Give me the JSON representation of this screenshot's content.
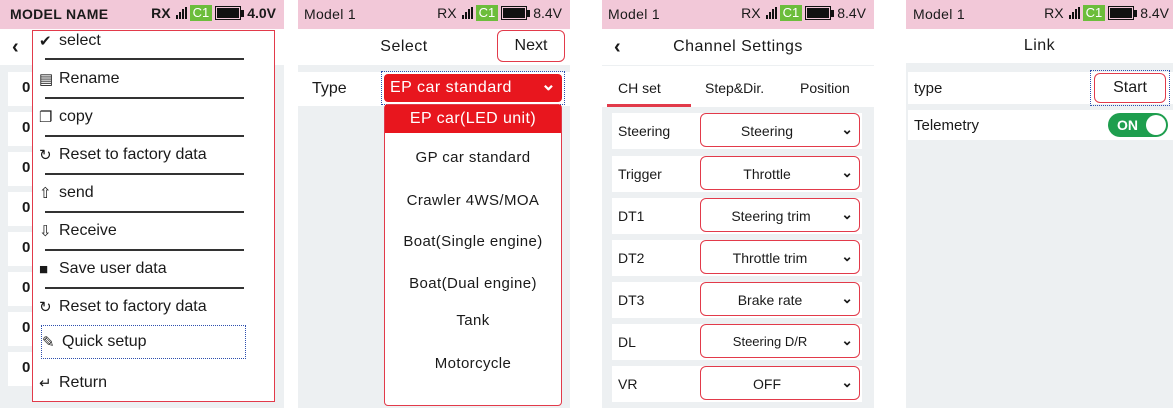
{
  "panel1": {
    "status": {
      "model": "MODEL NAME",
      "rx": "RX",
      "channel": "C1",
      "battery": "4.0V"
    },
    "back_glyph": "‹",
    "bg_rows": [
      "0",
      "0",
      "0",
      "0",
      "0",
      "0",
      "0",
      "0",
      "0"
    ],
    "menu": [
      {
        "icon": "check-icon",
        "glyph": "✔",
        "label": "select"
      },
      {
        "icon": "rename-icon",
        "glyph": "▤",
        "label": "Rename"
      },
      {
        "icon": "copy-icon",
        "glyph": "❐",
        "label": "copy"
      },
      {
        "icon": "refresh-icon",
        "glyph": "↻",
        "label": "Reset to factory data"
      },
      {
        "icon": "upload-icon",
        "glyph": "⇧",
        "label": "send"
      },
      {
        "icon": "download-icon",
        "glyph": "⇩",
        "label": "Receive"
      },
      {
        "icon": "save-icon",
        "glyph": "■",
        "label": "Save user data"
      },
      {
        "icon": "refresh-icon",
        "glyph": "↻",
        "label": "Reset to factory data"
      },
      {
        "icon": "pencil-icon",
        "glyph": "✎",
        "label": "Quick setup"
      },
      {
        "icon": "return-icon",
        "glyph": "↵",
        "label": "Return"
      }
    ]
  },
  "panel2": {
    "status": {
      "model": "Model 1",
      "rx": "RX",
      "channel": "C1",
      "battery": "8.4V"
    },
    "title": "Select",
    "next_label": "Next",
    "type_label": "Type",
    "type_value": "EP car standard",
    "chevron_glyph": "⌄",
    "options": [
      "EP car(LED unit)",
      "GP car standard",
      "Crawler 4WS/MOA",
      "Boat(Single engine)",
      "Boat(Dual engine)",
      "Tank",
      "Motorcycle"
    ],
    "highlight_color": "#e8161e"
  },
  "panel3": {
    "status": {
      "model": "Model 1",
      "rx": "RX",
      "channel": "C1",
      "battery": "8.4V"
    },
    "title": "Channel Settings",
    "back_glyph": "‹",
    "tabs": [
      "CH set",
      "Step&Dir.",
      "Position"
    ],
    "rows": [
      {
        "label": "Steering",
        "value": "Steering"
      },
      {
        "label": "Trigger",
        "value": "Throttle"
      },
      {
        "label": "DT1",
        "value": "Steering trim"
      },
      {
        "label": "DT2",
        "value": "Throttle trim"
      },
      {
        "label": "DT3",
        "value": "Brake rate"
      },
      {
        "label": "DL",
        "value": "Steering D/R"
      },
      {
        "label": "VR",
        "value": "OFF"
      }
    ],
    "chevron_glyph": "⌄"
  },
  "panel4": {
    "status": {
      "model": "Model 1",
      "rx": "RX",
      "channel": "C1",
      "battery": "8.4V"
    },
    "title": "Link",
    "type_label": "type",
    "start_label": "Start",
    "telemetry_label": "Telemetry",
    "toggle_label": "ON",
    "toggle_color": "#1e9e4e"
  },
  "colors": {
    "accent": "#e23a4a",
    "status_bar": "#f2c8d8",
    "channel_badge": "#6cbd3b",
    "focus_dotted": "#2d4fae"
  }
}
